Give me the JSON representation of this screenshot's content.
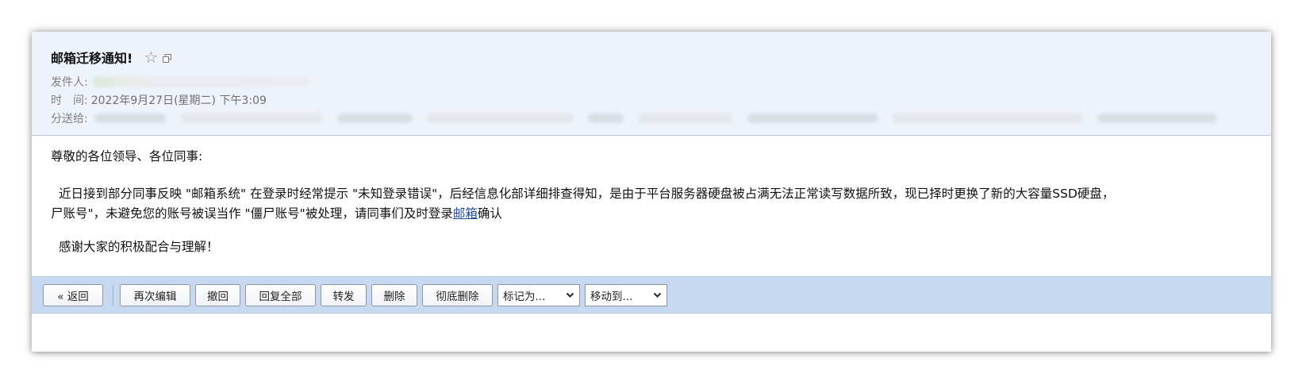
{
  "mail": {
    "subject": "邮箱迁移通知!",
    "sender_label": "发件人:",
    "time_label": "时　间:",
    "time_value": "2022年9月27日(星期二) 下午3:09",
    "recipients_label": "分送给:"
  },
  "body": {
    "greeting": "尊敬的各位领导、各位同事:",
    "para1_line1": "近日接到部分同事反映 \"邮箱系统\" 在登录时经常提示 \"未知登录错误\"，后经信息化部详细排查得知，是由于平台服务器硬盘被占满无法正常读写数据所致，现已择时更换了新的大容量SSD硬盘，",
    "para1_line2_prefix": "尸账号\"，未避免您的账号被误当作 \"僵尸账号\"被处理，请同事们及时登录",
    "link_text": "邮箱",
    "para1_line2_suffix": "确认",
    "thanks": "感谢大家的积极配合与理解！"
  },
  "toolbar": {
    "back": "« 返回",
    "edit_again": "再次编辑",
    "recall": "撤回",
    "reply_all": "回复全部",
    "forward": "转发",
    "delete": "删除",
    "delete_permanent": "彻底删除",
    "mark_as": "标记为...",
    "move_to": "移动到..."
  },
  "icons": {
    "star": "star-icon",
    "popout": "popout-window-icon",
    "dropdown": "chevron-down-icon"
  },
  "colors": {
    "header_bg": "#eef3fb",
    "toolbar_bg": "#c6d9f1",
    "link": "#1f4ba5"
  }
}
